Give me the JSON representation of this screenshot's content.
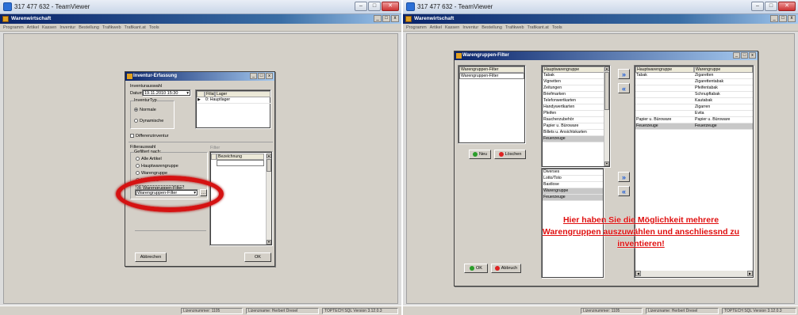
{
  "left": {
    "window_title": "317 477 632 - TeamViewer",
    "app_title": "Warenwirtschaft",
    "menu": [
      "Programm",
      "Artikel",
      "Kassen",
      "Inventur",
      "Bestellung",
      "Trafikweb",
      "Trafikant.at",
      "Tools"
    ],
    "dialog": {
      "title": "Inventur-Erfassung",
      "inventurauswahl": "Inventurauswahl",
      "datum_label": "Datum",
      "datum_value": "19.11.2010 15:30",
      "inventurtyp_label": "InventurTyp",
      "radio_normale": "Normale",
      "radio_dynamische": "Dynamische",
      "col_filiale": "Filiale",
      "col_lager": "Lager",
      "row_lager": "0: Hauptlager",
      "differenzinventur": "Differenzinventur",
      "filterauswahl": "Filterauswahl",
      "gefiltert_nach": "Gefiltert nach:",
      "filter_label": "Filter",
      "opt_alle": "Alle Artikel",
      "opt_haupt": "Hauptwarengruppe",
      "opt_waren": "Warengruppe",
      "opt_lieferant": "Lieferant",
      "opt_filter": "Warengruppen-Filter",
      "combo_value": "Warengruppen-Filter",
      "col_bezeichnung": "Bezeichnung",
      "btn_abbrechen": "Abbrechen",
      "btn_ok": "OK"
    },
    "status": {
      "lizenz": "Lizenznummer: 1105",
      "name": "Lizenzname: Herbert Drexel",
      "version": "TOPTECH SQL Version 3.12.0.3"
    }
  },
  "right": {
    "window_title": "317 477 632 - TeamViewer",
    "app_title": "Warenwirtschaft",
    "menu": [
      "Programm",
      "Artikel",
      "Kassen",
      "Inventur",
      "Bestellung",
      "Trafikweb",
      "Trafikant.at",
      "Tools"
    ],
    "dialog": {
      "title": "Warengruppen-Filter",
      "filter_header": "Warengruppen-Filter",
      "filter_row": "Warengruppen-Filter",
      "btn_neu": "Neu",
      "btn_loeschen": "Löschen",
      "btn_ok": "OK",
      "btn_abbruch": "Abbruch",
      "hwg_header": "Hauptwarengruppe",
      "hwg_items": [
        "Tabak",
        "Vignetten",
        "Zeitungen",
        "Briefmarken",
        "Telefonwertkarten",
        "Handywertkarten",
        "Pfeifen",
        "Raucherzubehör",
        "Papier u. Büroware",
        "Billets u. Ansichtskarten",
        "Feuerzeuge"
      ],
      "wg_header": "Warengruppe",
      "wg_items": [
        "Diverses",
        "Lotto/Toto",
        "Bastlose",
        "Warengruppe",
        "Feuerzeuge"
      ],
      "sel_col1_header": "Hauptwarengruppe",
      "sel_col2_header": "Warengruppe",
      "sel_rows": [
        [
          "Tabak",
          "Zigaretten"
        ],
        [
          "",
          "Zigarettentabak"
        ],
        [
          "",
          "Pfeifentabak"
        ],
        [
          "",
          "Schnupftabak"
        ],
        [
          "",
          "Kautabak"
        ],
        [
          "",
          "Zigarren"
        ],
        [
          "",
          "Evita"
        ],
        [
          "Papier u. Büroware",
          "Papier u. Büroware"
        ],
        [
          "Feuerzeuge",
          "Feuerzeuge"
        ]
      ],
      "arrow_add": "»",
      "arrow_remove": "«"
    },
    "annotation": [
      "Hier haben Sie die Möglichkeit mehrere",
      "Warengruppen auszuwählen und anschliessnd zu",
      "inventieren!"
    ],
    "status": {
      "lizenz": "Lizenznummer: 1105",
      "name": "Lizenzname: Herbert Drexel",
      "version": "TOPTECH SQL Version 3.12.0.3"
    }
  },
  "colors": {
    "annotation_red": "#e01010",
    "circle_red": "#d51212"
  }
}
